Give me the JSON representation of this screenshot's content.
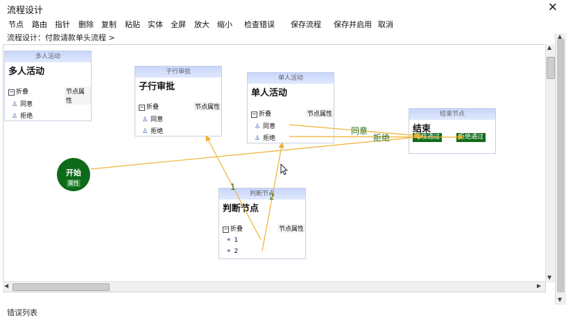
{
  "window": {
    "title": "流程设计",
    "close_glyph": "✕"
  },
  "menu": {
    "items": [
      "节点",
      "路由",
      "指针",
      "删除",
      "复制",
      "粘贴",
      "实体",
      "全屏",
      "放大",
      "缩小",
      "检查错误",
      "保存流程",
      "保存并启用",
      "取消"
    ]
  },
  "breadcrumb": "流程设计：付款请款单头流程 >",
  "nodes": {
    "multi": {
      "header": "多人活动",
      "name": "多人活动",
      "fold": "折叠",
      "props": "节点属性",
      "items": [
        "同意",
        "拒绝"
      ]
    },
    "sub": {
      "header": "子行审批",
      "name": "子行审批",
      "fold": "折叠",
      "props": "节点属性",
      "items": [
        "同意",
        "拒绝"
      ]
    },
    "single": {
      "header": "单人活动",
      "name": "单人活动",
      "fold": "折叠",
      "props": "节点属性",
      "items": [
        "同意",
        "拒绝"
      ]
    },
    "end": {
      "header": "结束节点",
      "name": "结束",
      "btn1": "审核通过",
      "btn2": "拒绝通过"
    },
    "judge": {
      "header": "判断节点",
      "name": "判断节点",
      "fold": "折叠",
      "props": "节点属性",
      "items": [
        "1",
        "2"
      ]
    },
    "start": {
      "name": "开始",
      "props": "属性"
    }
  },
  "wires": {
    "agree": "同意",
    "reject": "拒绝",
    "one": "1",
    "two": "2"
  },
  "bottom_panel": {
    "label": "错误列表"
  },
  "colors": {
    "wire": "#f0b030",
    "start": "#0d6a18",
    "node_header": "#c8d6fb"
  },
  "icons": {
    "close": "close-icon",
    "user": "user-icon",
    "link": "link-icon",
    "cursor": "cursor-icon"
  }
}
